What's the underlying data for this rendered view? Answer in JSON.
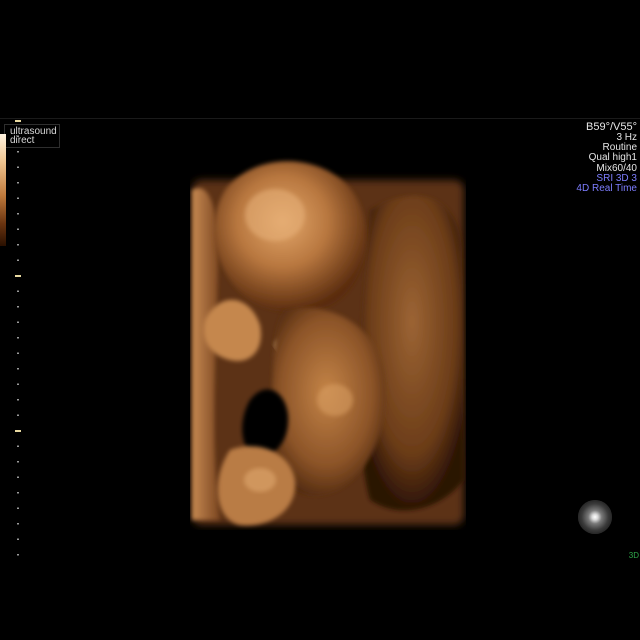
{
  "brand": {
    "line1": "ultrasound",
    "line2": "direct"
  },
  "info_panel": {
    "angle": "B59°/V55°",
    "rate": "3 Hz",
    "program": "Routine",
    "quality": "Qual high1",
    "mix": "Mix60/40",
    "sri": "SRI 3D 3",
    "mode": "4D Real Time"
  },
  "corner_label": "3D",
  "colors": {
    "background": "#000000",
    "mode_text": "#7d7dff",
    "info_text": "#e6e6e6",
    "corner_label": "#2fa84a",
    "render_tone": "#b0703a"
  },
  "icons": {
    "nav": "trackball-icon"
  }
}
